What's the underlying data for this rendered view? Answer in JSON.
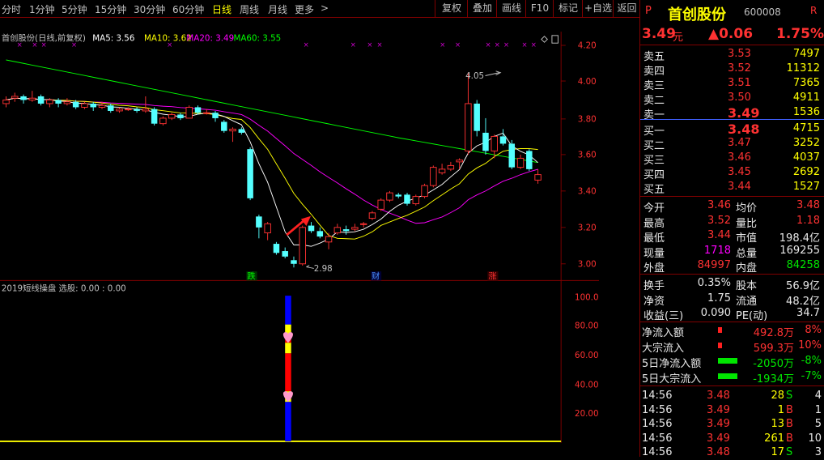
{
  "toolbar": {
    "periods": [
      "分时",
      "1分钟",
      "5分钟",
      "15分钟",
      "30分钟",
      "60分钟",
      "日线",
      "周线",
      "月线",
      "更多"
    ],
    "active_period": "日线",
    "more_arrow": ">",
    "buttons": [
      "复权",
      "叠加",
      "画线",
      "F10",
      "标记",
      "+自选",
      "返回"
    ]
  },
  "legend": {
    "title": "首创股份(日线,前复权)",
    "ma5": "MA5: 3.56",
    "ma10": "MA10: 3.62",
    "ma20": "MA20: 3.49",
    "ma60": "MA60: 3.55",
    "colors": {
      "ma5": "#ffffff",
      "ma10": "#ffff00",
      "ma20": "#ff00ff",
      "ma60": "#00ff00"
    }
  },
  "price_axis": [
    "4.20",
    "4.00",
    "3.80",
    "3.60",
    "3.40",
    "3.20",
    "3.00"
  ],
  "annotations": {
    "high_label": "4.05",
    "low_label": "2.98",
    "markers": [
      "跌",
      "财",
      "涨"
    ]
  },
  "indicator": {
    "title": "2019短线操盘 选股: 0.00 : 0.00",
    "axis": [
      "100.00",
      "80.00",
      "60.00",
      "40.00",
      "20.00"
    ]
  },
  "quote": {
    "p_label": "P",
    "name": "首创股份",
    "code": "600008",
    "r_label": "R",
    "price": "3.49",
    "unit": "元",
    "change": "▲0.06",
    "pct": "1.75%"
  },
  "sells": [
    {
      "label": "卖五",
      "price": "3.53",
      "vol": "7497"
    },
    {
      "label": "卖四",
      "price": "3.52",
      "vol": "11312"
    },
    {
      "label": "卖三",
      "price": "3.51",
      "vol": "7365"
    },
    {
      "label": "卖二",
      "price": "3.50",
      "vol": "4911"
    },
    {
      "label": "卖一",
      "price": "3.49",
      "vol": "1536"
    }
  ],
  "buys": [
    {
      "label": "买一",
      "price": "3.48",
      "vol": "4715"
    },
    {
      "label": "买二",
      "price": "3.47",
      "vol": "3252"
    },
    {
      "label": "买三",
      "price": "3.46",
      "vol": "4037"
    },
    {
      "label": "买四",
      "price": "3.45",
      "vol": "2692"
    },
    {
      "label": "买五",
      "price": "3.44",
      "vol": "1527"
    }
  ],
  "stats": [
    {
      "l1": "今开",
      "v1": "3.46",
      "l2": "均价",
      "v2": "3.48",
      "c1": "red",
      "c2": "red"
    },
    {
      "l1": "最高",
      "v1": "3.52",
      "l2": "量比",
      "v2": "1.18",
      "c1": "red",
      "c2": "red"
    },
    {
      "l1": "最低",
      "v1": "3.44",
      "l2": "市值",
      "v2": "198.4亿",
      "c1": "red",
      "c2": "white"
    },
    {
      "l1": "现量",
      "v1": "1718",
      "l2": "总量",
      "v2": "169255",
      "c1": "mag",
      "c2": "white"
    },
    {
      "l1": "外盘",
      "v1": "84997",
      "l2": "内盘",
      "v2": "84258",
      "c1": "red",
      "c2": "green"
    }
  ],
  "stats2": [
    {
      "l1": "换手",
      "v1": "0.35%",
      "l2": "股本",
      "v2": "56.9亿"
    },
    {
      "l1": "净资",
      "v1": "1.75",
      "l2": "流通",
      "v2": "48.2亿"
    },
    {
      "l1": "收益(三)",
      "v1": "0.090",
      "l2": "PE(动)",
      "v2": "34.7"
    }
  ],
  "flows": [
    {
      "label": "净流入额",
      "val": "492.8万",
      "pct": "8%",
      "color": "red"
    },
    {
      "label": "大宗流入",
      "val": "599.3万",
      "pct": "10%",
      "color": "red"
    },
    {
      "label": "5日净流入额",
      "val": "-2050万",
      "pct": "-8%",
      "color": "green"
    },
    {
      "label": "5日大宗流入",
      "val": "-1934万",
      "pct": "-7%",
      "color": "green"
    }
  ],
  "ticks": [
    {
      "t": "14:56",
      "p": "3.48",
      "v": "28",
      "s": "S",
      "n": "4",
      "pc": "red",
      "sc": "green"
    },
    {
      "t": "14:56",
      "p": "3.49",
      "v": "1",
      "s": "B",
      "n": "1",
      "pc": "red",
      "sc": "red"
    },
    {
      "t": "14:56",
      "p": "3.49",
      "v": "13",
      "s": "B",
      "n": "5",
      "pc": "red",
      "sc": "red"
    },
    {
      "t": "14:56",
      "p": "3.49",
      "v": "261",
      "s": "B",
      "n": "10",
      "pc": "red",
      "sc": "red"
    },
    {
      "t": "14:56",
      "p": "3.48",
      "v": "17",
      "s": "S",
      "n": "3",
      "pc": "red",
      "sc": "green"
    }
  ],
  "candles": [
    {
      "o": 3.88,
      "c": 3.9,
      "h": 3.92,
      "l": 3.86
    },
    {
      "o": 3.91,
      "c": 3.92,
      "h": 3.94,
      "l": 3.89
    },
    {
      "o": 3.92,
      "c": 3.9,
      "h": 3.93,
      "l": 3.88
    },
    {
      "o": 3.9,
      "c": 3.91,
      "h": 3.95,
      "l": 3.89
    },
    {
      "o": 3.92,
      "c": 3.88,
      "h": 3.93,
      "l": 3.87
    },
    {
      "o": 3.88,
      "c": 3.9,
      "h": 3.91,
      "l": 3.86
    },
    {
      "o": 3.9,
      "c": 3.88,
      "h": 3.91,
      "l": 3.86
    },
    {
      "o": 3.88,
      "c": 3.89,
      "h": 3.91,
      "l": 3.87
    },
    {
      "o": 3.89,
      "c": 3.86,
      "h": 3.9,
      "l": 3.85
    },
    {
      "o": 3.86,
      "c": 3.88,
      "h": 3.89,
      "l": 3.85
    },
    {
      "o": 3.88,
      "c": 3.86,
      "h": 3.89,
      "l": 3.84
    },
    {
      "o": 3.86,
      "c": 3.87,
      "h": 3.89,
      "l": 3.85
    },
    {
      "o": 3.87,
      "c": 3.84,
      "h": 3.88,
      "l": 3.83
    },
    {
      "o": 3.84,
      "c": 3.85,
      "h": 3.86,
      "l": 3.83
    },
    {
      "o": 3.85,
      "c": 3.85,
      "h": 3.86,
      "l": 3.84
    },
    {
      "o": 3.85,
      "c": 3.84,
      "h": 3.86,
      "l": 3.83
    },
    {
      "o": 3.84,
      "c": 3.85,
      "h": 3.92,
      "l": 3.83
    },
    {
      "o": 3.85,
      "c": 3.77,
      "h": 3.86,
      "l": 3.76
    },
    {
      "o": 3.77,
      "c": 3.8,
      "h": 3.81,
      "l": 3.76
    },
    {
      "o": 3.8,
      "c": 3.82,
      "h": 3.83,
      "l": 3.79
    },
    {
      "o": 3.82,
      "c": 3.8,
      "h": 3.83,
      "l": 3.79
    },
    {
      "o": 3.8,
      "c": 3.86,
      "h": 3.87,
      "l": 3.8
    },
    {
      "o": 3.86,
      "c": 3.83,
      "h": 3.87,
      "l": 3.82
    },
    {
      "o": 3.83,
      "c": 3.83,
      "h": 3.85,
      "l": 3.82
    },
    {
      "o": 3.83,
      "c": 3.8,
      "h": 3.84,
      "l": 3.78
    },
    {
      "o": 3.78,
      "c": 3.73,
      "h": 3.79,
      "l": 3.72
    },
    {
      "o": 3.73,
      "c": 3.74,
      "h": 3.75,
      "l": 3.67
    },
    {
      "o": 3.74,
      "c": 3.72,
      "h": 3.75,
      "l": 3.71
    },
    {
      "o": 3.63,
      "c": 3.36,
      "h": 3.64,
      "l": 3.35
    },
    {
      "o": 3.26,
      "c": 3.2,
      "h": 3.27,
      "l": 3.14
    },
    {
      "o": 3.17,
      "c": 3.22,
      "h": 3.23,
      "l": 3.13
    },
    {
      "o": 3.11,
      "c": 3.06,
      "h": 3.12,
      "l": 3.05
    },
    {
      "o": 3.07,
      "c": 3.04,
      "h": 3.09,
      "l": 3.03
    },
    {
      "o": 3.02,
      "c": 3.0,
      "h": 3.04,
      "l": 2.98
    },
    {
      "o": 3.0,
      "c": 3.2,
      "h": 3.21,
      "l": 2.99
    },
    {
      "o": 3.21,
      "c": 3.18,
      "h": 3.23,
      "l": 3.17
    },
    {
      "o": 3.18,
      "c": 3.15,
      "h": 3.2,
      "l": 3.14
    },
    {
      "o": 3.12,
      "c": 3.15,
      "h": 3.17,
      "l": 3.08
    },
    {
      "o": 3.17,
      "c": 3.2,
      "h": 3.22,
      "l": 3.16
    },
    {
      "o": 3.19,
      "c": 3.18,
      "h": 3.21,
      "l": 3.16
    },
    {
      "o": 3.19,
      "c": 3.2,
      "h": 3.22,
      "l": 3.18
    },
    {
      "o": 3.22,
      "c": 3.22,
      "h": 3.23,
      "l": 3.2
    },
    {
      "o": 3.25,
      "c": 3.28,
      "h": 3.29,
      "l": 3.24
    },
    {
      "o": 3.3,
      "c": 3.35,
      "h": 3.36,
      "l": 3.29
    },
    {
      "o": 3.35,
      "c": 3.39,
      "h": 3.4,
      "l": 3.34
    },
    {
      "o": 3.38,
      "c": 3.37,
      "h": 3.39,
      "l": 3.36
    },
    {
      "o": 3.38,
      "c": 3.33,
      "h": 3.39,
      "l": 3.32
    },
    {
      "o": 3.33,
      "c": 3.37,
      "h": 3.38,
      "l": 3.32
    },
    {
      "o": 3.37,
      "c": 3.43,
      "h": 3.44,
      "l": 3.36
    },
    {
      "o": 3.43,
      "c": 3.53,
      "h": 3.54,
      "l": 3.42
    },
    {
      "o": 3.5,
      "c": 3.52,
      "h": 3.55,
      "l": 3.49
    },
    {
      "o": 3.52,
      "c": 3.54,
      "h": 3.56,
      "l": 3.51
    },
    {
      "o": 3.56,
      "c": 3.57,
      "h": 3.58,
      "l": 3.52
    },
    {
      "o": 3.62,
      "c": 3.88,
      "h": 4.05,
      "l": 3.6
    },
    {
      "o": 3.88,
      "c": 3.73,
      "h": 3.9,
      "l": 3.7
    },
    {
      "o": 3.72,
      "c": 3.62,
      "h": 3.8,
      "l": 3.6
    },
    {
      "o": 3.62,
      "c": 3.7,
      "h": 3.71,
      "l": 3.58
    },
    {
      "o": 3.7,
      "c": 3.66,
      "h": 3.74,
      "l": 3.65
    },
    {
      "o": 3.66,
      "c": 3.53,
      "h": 3.68,
      "l": 3.52
    },
    {
      "o": 3.53,
      "c": 3.58,
      "h": 3.6,
      "l": 3.52
    },
    {
      "o": 3.62,
      "c": 3.52,
      "h": 3.63,
      "l": 3.51
    },
    {
      "o": 3.46,
      "c": 3.49,
      "h": 3.52,
      "l": 3.44
    }
  ]
}
